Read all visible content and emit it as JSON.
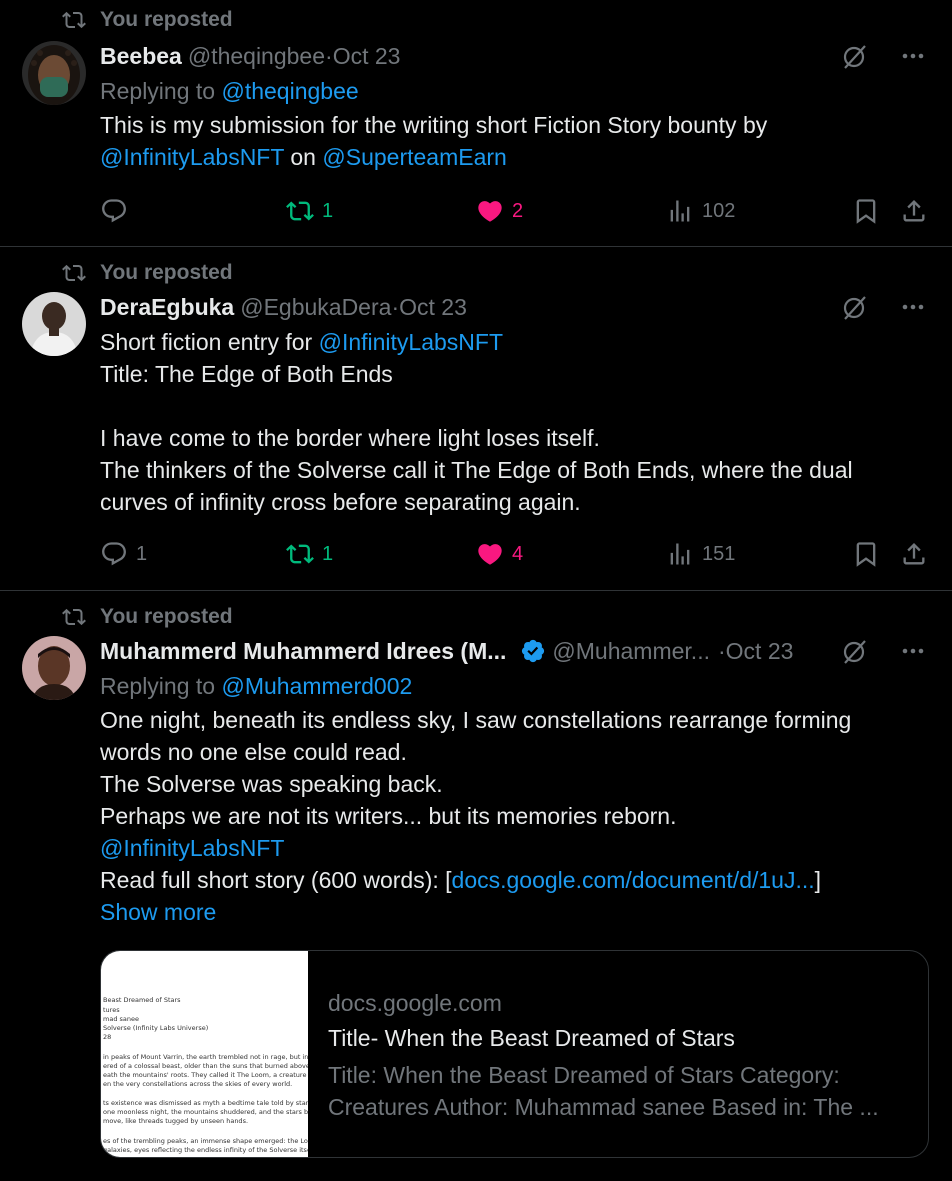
{
  "repost_label": "You reposted",
  "tweets": [
    {
      "name": "Beebea",
      "handle": "@theqingbee",
      "sep": " · ",
      "date": "Oct 23",
      "replying_prefix": "Replying to ",
      "replying_to": "@theqingbee",
      "text_line1": "This is my submission for the writing short Fiction Story bounty by",
      "mention1": "@InfinityLabsNFT",
      "on": " on ",
      "mention2": "@SuperteamEarn",
      "replies": "",
      "reposts": "1",
      "likes": "2",
      "views": "102"
    },
    {
      "name": "DeraEgbuka",
      "handle": "@EgbukaDera",
      "sep": " · ",
      "date": "Oct 23",
      "line1_prefix": "Short fiction entry for ",
      "mention1": "@InfinityLabsNFT",
      "line2": "Title: The Edge of Both Ends",
      "line3": "I have come to the border where light loses itself.",
      "line4": "The thinkers of the Solverse call it The Edge of Both Ends, where the dual",
      "line5": "curves of infinity cross before separating again.",
      "replies": "1",
      "reposts": "1",
      "likes": "4",
      "views": "151"
    },
    {
      "name": "Muhammerd Muhammerd Idrees (M...",
      "handle": "@Muhammer...",
      "sep": " · ",
      "date": "Oct 23",
      "replying_prefix": "Replying to ",
      "replying_to": "@Muhammerd002",
      "line1": "One night, beneath its endless sky, I saw constellations rearrange forming",
      "line2": "words no one else could read.",
      "line3": "The Solverse was speaking back.",
      "line4": "Perhaps we are not its writers... but its memories reborn.",
      "mention1": "@InfinityLabsNFT",
      "line6_prefix": "Read full short story (600 words): [",
      "line6_link": "docs.google.com/document/d/1uJ...",
      "line6_suffix": "]",
      "show_more": "Show more",
      "card": {
        "domain": "docs.google.com",
        "title": "Title- When the Beast Dreamed of Stars",
        "desc1": "Title: When the Beast Dreamed of Stars Category:",
        "desc2": "Creatures Author: Muhammad sanee Based in: The ...",
        "thumb_lines": [
          "Beast Dreamed of Stars",
          "tures",
          "mad sanee",
          "Solverse (Infinity Labs Universe)",
          "28",
          "",
          "in peaks of Mount Varrin, the earth trembled not in rage, but in awe",
          "ered of a colossal beast, older than the suns that burned above th",
          "eath the mountains' roots. They called it The Loom, a creature of",
          "en the very constellations across the skies of every world.",
          "",
          "ts existence was dismissed as myth a bedtime tale told by stargaz",
          "one moonless night, the mountains shuddered, and the stars bega",
          "move, like threads tugged by unseen hands.",
          "",
          "es of the trembling peaks, an immense shape emerged: the Loom",
          "galaxies, eyes reflecting the endless infinity of the Solverse itself"
        ]
      }
    }
  ],
  "colors": {
    "background": "#000000",
    "text": "#e7e9ea",
    "muted": "#71767b",
    "link": "#1d9bf0",
    "repost_green": "#00ba7c",
    "like_pink": "#f91880",
    "divider": "#2f3336"
  }
}
